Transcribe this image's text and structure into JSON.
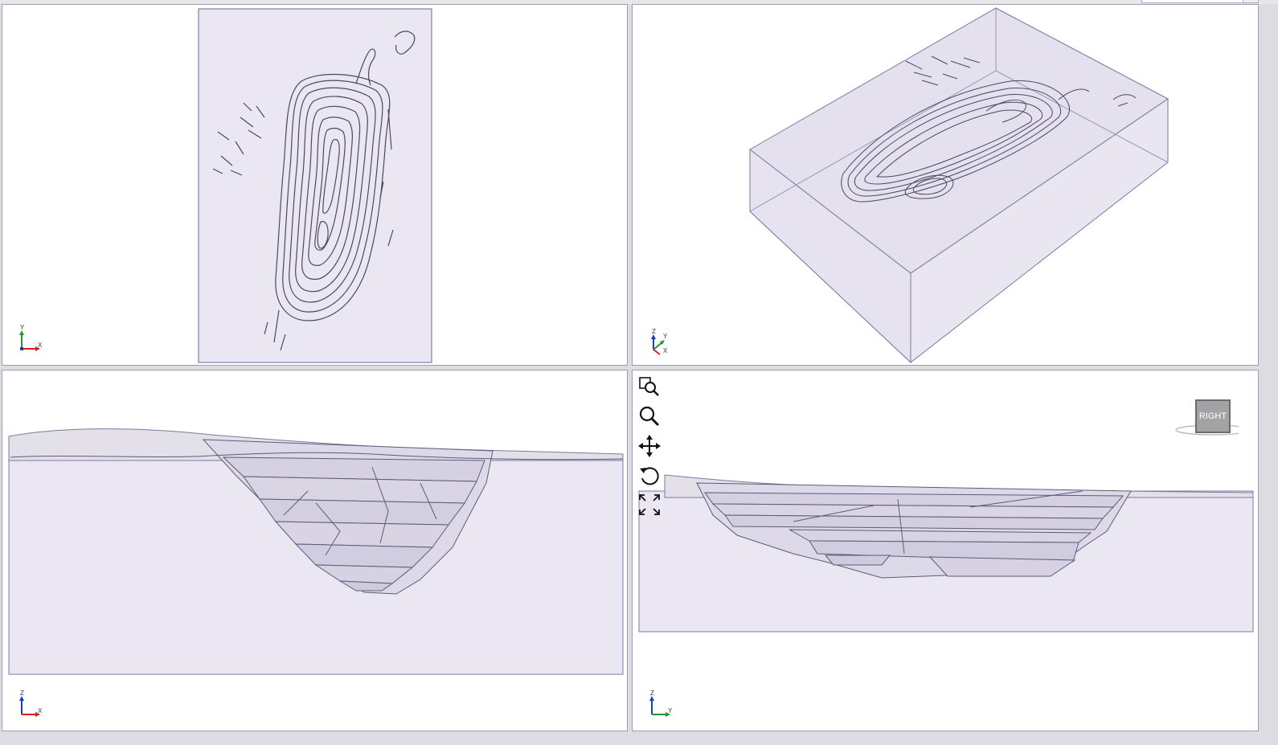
{
  "viewports": [
    {
      "name": "top-view",
      "axes": {
        "vertical": "Y",
        "horizontal": "X"
      }
    },
    {
      "name": "perspective-view",
      "axes": {
        "vertical": "Z",
        "second": "Y",
        "horizontal": "X"
      }
    },
    {
      "name": "front-view",
      "axes": {
        "vertical": "Z",
        "horizontal": "X"
      }
    },
    {
      "name": "side-view",
      "axes": {
        "vertical": "Z",
        "horizontal": "Y"
      }
    }
  ],
  "toolbar": {
    "icons": [
      "zoom-window-icon",
      "zoom-icon",
      "pan-icon",
      "rotate-icon",
      "fit-all-icon"
    ]
  },
  "view_cube": {
    "label": "RIGHT"
  },
  "colors": {
    "model_fill": "#ebe7f2",
    "model_stroke": "#5e5a78",
    "contour": "#4b4766",
    "axis_z": "#1a3dc8",
    "axis_x": "#d81f1f",
    "axis_y": "#1f9a2d"
  }
}
